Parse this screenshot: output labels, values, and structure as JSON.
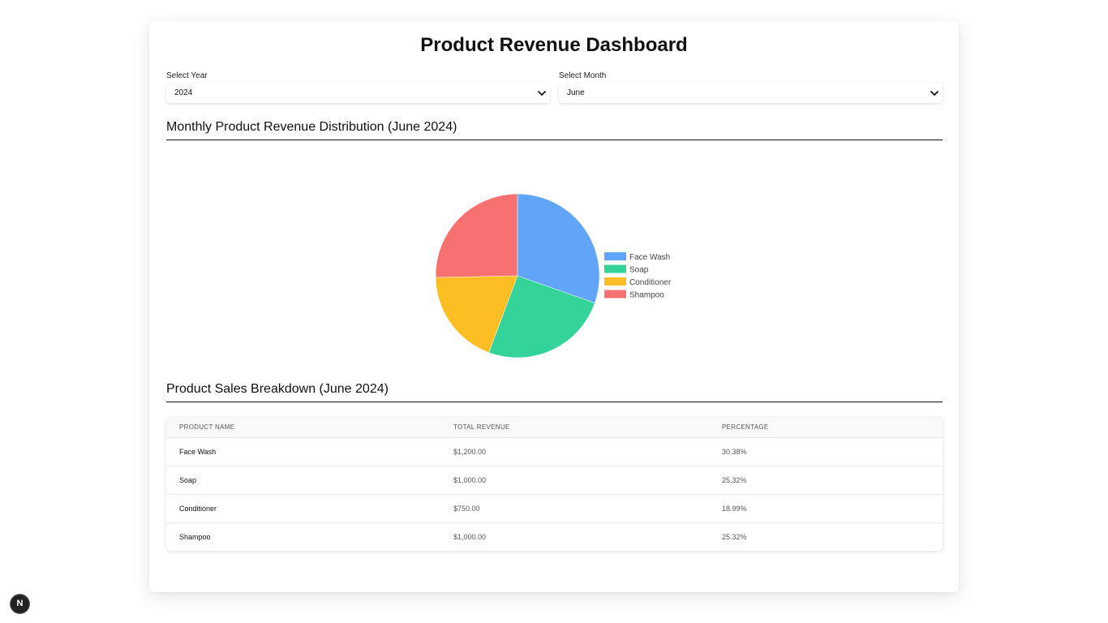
{
  "page": {
    "title": "Product Revenue Dashboard"
  },
  "filters": {
    "year": {
      "label": "Select Year",
      "value": "2024"
    },
    "month": {
      "label": "Select Month",
      "value": "June"
    }
  },
  "chart_section": {
    "title": "Monthly Product Revenue Distribution (June 2024)"
  },
  "chart_data": {
    "type": "pie",
    "categories": [
      "Face Wash",
      "Soap",
      "Conditioner",
      "Shampoo"
    ],
    "values": [
      1200,
      1000,
      750,
      1000
    ],
    "colors": [
      "#60a5fa",
      "#34d399",
      "#fbbf24",
      "#f87171"
    ],
    "title": "",
    "legend": "right"
  },
  "table_section": {
    "title": "Product Sales Breakdown (June 2024)"
  },
  "table": {
    "columns": [
      "Product Name",
      "Total Revenue",
      "Percentage"
    ],
    "rows": [
      [
        "Face Wash",
        "$1,200.00",
        "30.38%"
      ],
      [
        "Soap",
        "$1,000.00",
        "25.32%"
      ],
      [
        "Conditioner",
        "$750.00",
        "18.99%"
      ],
      [
        "Shampoo",
        "$1,000.00",
        "25.32%"
      ]
    ]
  },
  "badge": {
    "label": "N"
  }
}
